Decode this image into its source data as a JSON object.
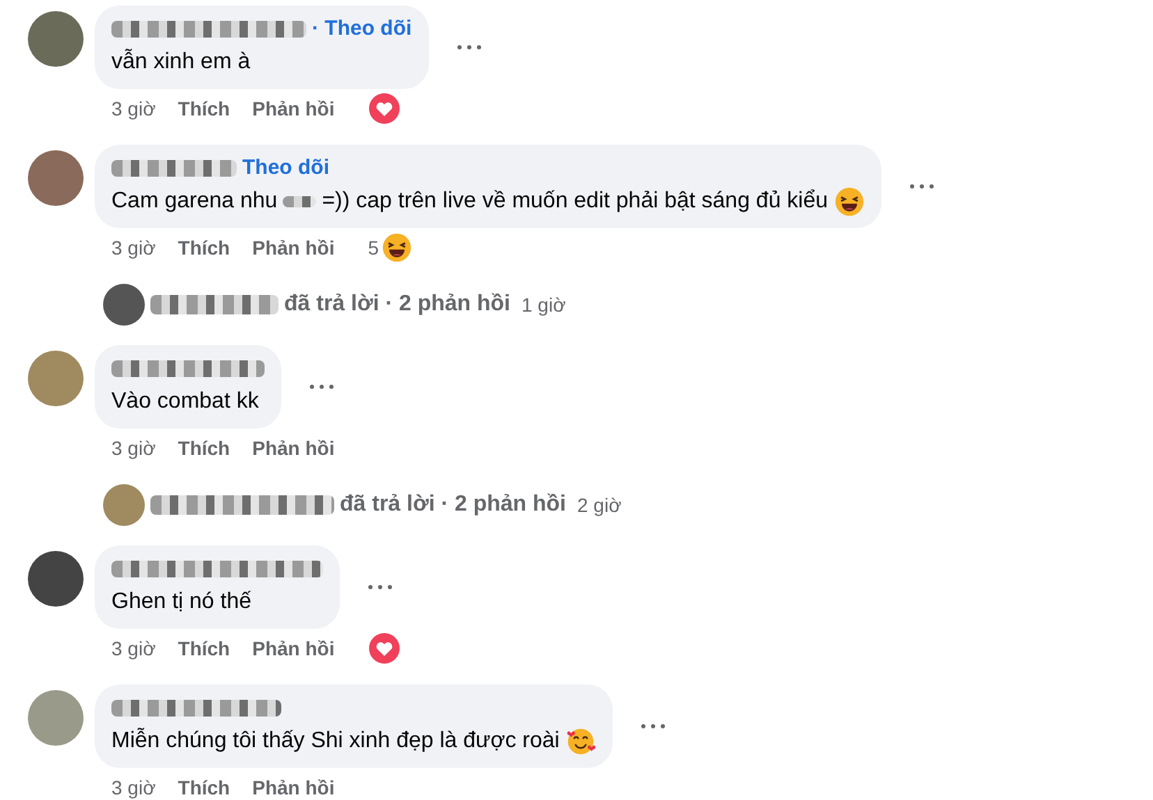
{
  "items": [
    {
      "kind": "comment",
      "follow": "· Theo dõi",
      "text": [
        "vẫn xinh em à"
      ],
      "time": "3 giờ",
      "like": "Thích",
      "reply": "Phản hồi",
      "reaction": {
        "kind": "heart"
      }
    },
    {
      "kind": "comment",
      "follow": "Theo dõi",
      "text": [
        "Cam garena nhu",
        "=)) cap trên live về muốn edit phải bật sáng đủ kiểu"
      ],
      "emoji": {
        "kind": "laugh"
      },
      "time": "3 giờ",
      "like": "Thích",
      "reply": "Phản hồi",
      "reaction": {
        "kind": "haha",
        "count": "5"
      }
    },
    {
      "kind": "replies",
      "summary": "đã trả lời · 2 phản hồi",
      "time": "1 giờ"
    },
    {
      "kind": "comment",
      "text": [
        "Vào combat kk"
      ],
      "time": "3 giờ",
      "like": "Thích",
      "reply": "Phản hồi"
    },
    {
      "kind": "replies",
      "summary": "đã trả lời · 2 phản hồi",
      "time": "2 giờ"
    },
    {
      "kind": "comment",
      "text": [
        "Ghen tị nó thế"
      ],
      "time": "3 giờ",
      "like": "Thích",
      "reply": "Phản hồi",
      "reaction": {
        "kind": "heart"
      }
    },
    {
      "kind": "comment",
      "text": [
        "Miễn chúng tôi thấy Shi xinh đẹp là được roài"
      ],
      "emoji": {
        "kind": "love"
      },
      "time": "3 giờ",
      "like": "Thích",
      "reply": "Phản hồi"
    }
  ]
}
